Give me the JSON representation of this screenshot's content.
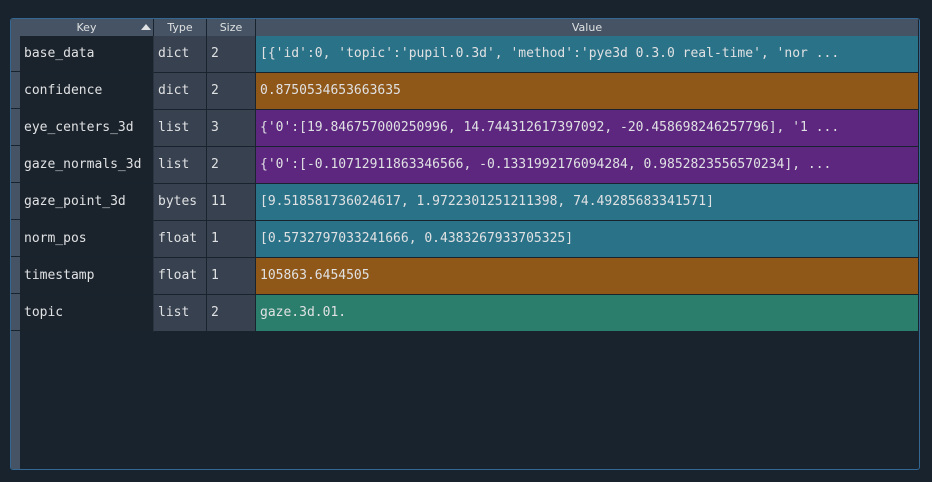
{
  "columns": {
    "key": "Key",
    "type": "Type",
    "size": "Size",
    "value": "Value"
  },
  "colors": {
    "teal": "#2a7288",
    "orange": "#8f5718",
    "purple": "#5d2780",
    "green": "#2b7e6b"
  },
  "rows": [
    {
      "key": "base_data",
      "type": "dict",
      "size": "2",
      "value": "[{'id':0, 'topic':'pupil.0.3d', 'method':'pye3d 0.3.0 real-time', 'nor ...",
      "color": "#2a7288"
    },
    {
      "key": "confidence",
      "type": "dict",
      "size": "2",
      "value": "0.8750534653663635",
      "color": "#8f5718"
    },
    {
      "key": "eye_centers_3d",
      "type": "list",
      "size": "3",
      "value": "{'0':[19.846757000250996, 14.744312617397092, -20.458698246257796], '1 ...",
      "color": "#5d2780"
    },
    {
      "key": "gaze_normals_3d",
      "type": "list",
      "size": "2",
      "value": "{'0':[-0.10712911863346566, -0.1331992176094284, 0.9852823556570234], ...",
      "color": "#5d2780"
    },
    {
      "key": "gaze_point_3d",
      "type": "bytes",
      "size": "11",
      "value": "[9.518581736024617, 1.9722301251211398, 74.49285683341571]",
      "color": "#2a7288"
    },
    {
      "key": "norm_pos",
      "type": "float",
      "size": "1",
      "value": "[0.5732797033241666, 0.4383267933705325]",
      "color": "#2a7288"
    },
    {
      "key": "timestamp",
      "type": "float",
      "size": "1",
      "value": "105863.6454505",
      "color": "#8f5718"
    },
    {
      "key": "topic",
      "type": "list",
      "size": "2",
      "value": "gaze.3d.01.",
      "color": "#2b7e6b"
    }
  ]
}
